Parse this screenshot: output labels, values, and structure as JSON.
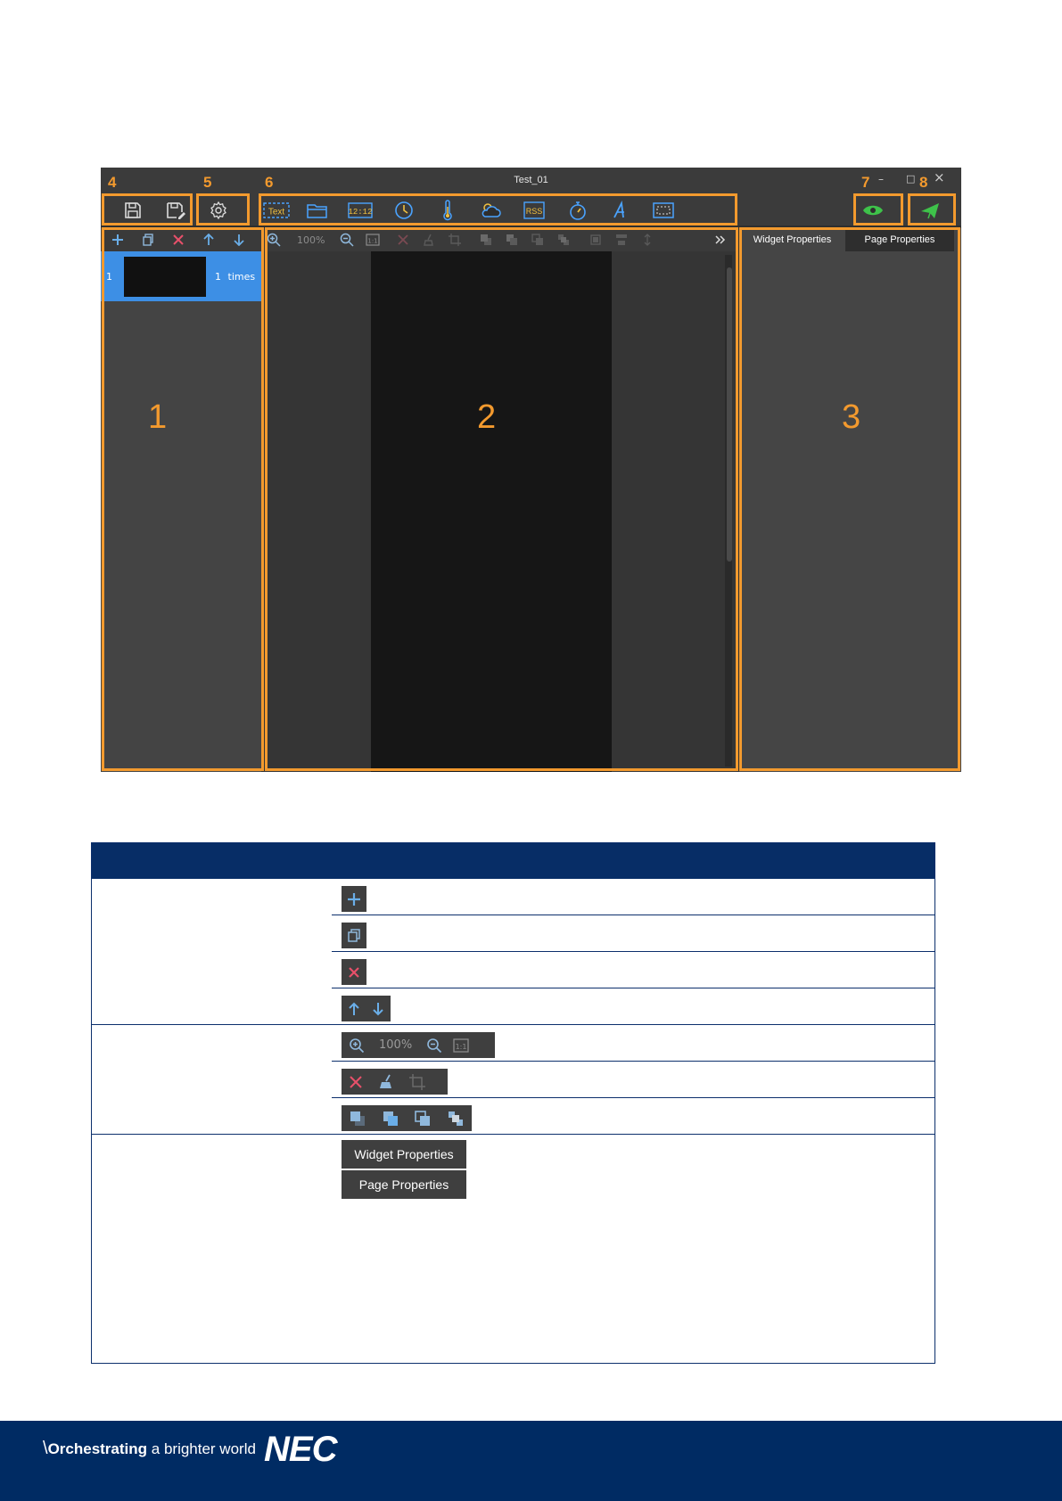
{
  "app": {
    "title": "Test_01",
    "window_controls": {
      "minimize": "–",
      "maximize": "□",
      "close": "×"
    },
    "page_list": {
      "item": {
        "index": "1",
        "repeat_count": "1",
        "repeat_unit": "times"
      }
    },
    "editor": {
      "zoom": "100%"
    },
    "properties": {
      "widget_tab": "Widget Properties",
      "page_tab": "Page Properties"
    },
    "toolbar_icons": [
      "text-icon",
      "folder-icon",
      "digital-clock-icon",
      "clock-icon",
      "thermometer-icon",
      "weather-icon",
      "rss-icon",
      "timer-icon",
      "font-icon",
      "region-icon"
    ],
    "accent_color": "#f39a2e",
    "selection_color": "#3d8fe5"
  },
  "callouts": {
    "area1": "1",
    "area2": "2",
    "area3": "3",
    "save": "4",
    "settings": "5",
    "widgets": "6",
    "preview": "7",
    "publish": "8"
  },
  "table": {
    "zoom_label": "100%",
    "widget_properties": "Widget Properties",
    "page_properties": "Page Properties",
    "header_color": "#072d66"
  },
  "footer": {
    "slogan_bold": "Orchestrating",
    "slogan_rest": " a brighter world",
    "logo": "NEC",
    "background": "#002b63"
  }
}
